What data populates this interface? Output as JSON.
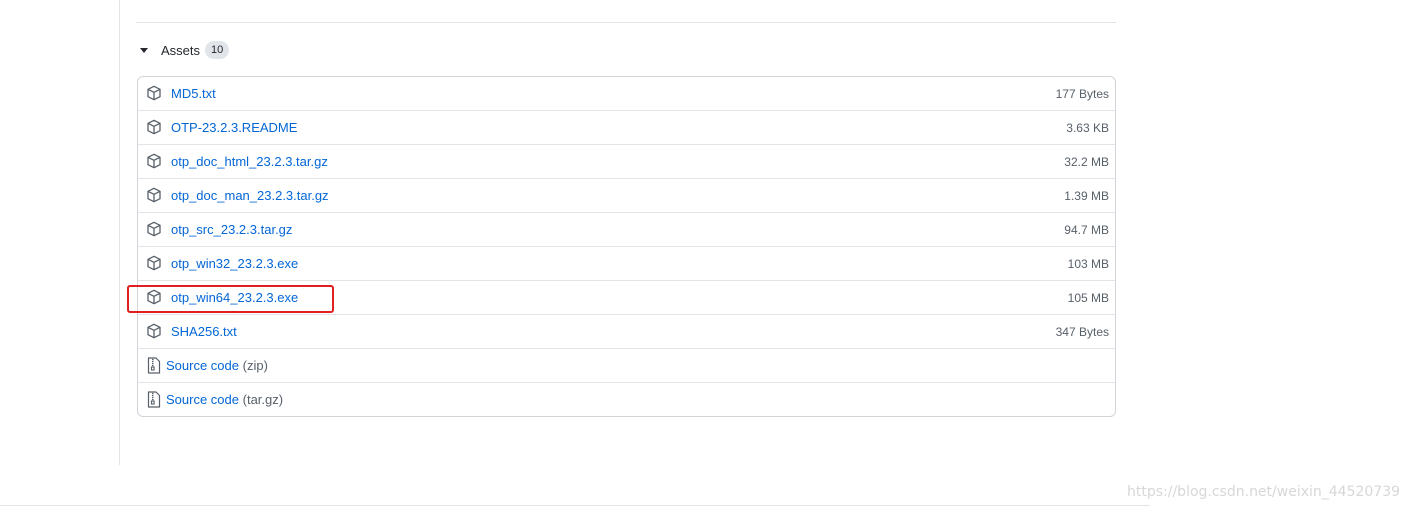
{
  "assets": {
    "title": "Assets",
    "count": "10",
    "items": [
      {
        "name": "MD5.txt",
        "size": "177 Bytes",
        "icon": "package-icon"
      },
      {
        "name": "OTP-23.2.3.README",
        "size": "3.63 KB",
        "icon": "package-icon"
      },
      {
        "name": "otp_doc_html_23.2.3.tar.gz",
        "size": "32.2 MB",
        "icon": "package-icon"
      },
      {
        "name": "otp_doc_man_23.2.3.tar.gz",
        "size": "1.39 MB",
        "icon": "package-icon"
      },
      {
        "name": "otp_src_23.2.3.tar.gz",
        "size": "94.7 MB",
        "icon": "package-icon"
      },
      {
        "name": "otp_win32_23.2.3.exe",
        "size": "103 MB",
        "icon": "package-icon"
      },
      {
        "name": "otp_win64_23.2.3.exe",
        "size": "105 MB",
        "icon": "package-icon",
        "highlighted": true
      },
      {
        "name": "SHA256.txt",
        "size": "347 Bytes",
        "icon": "package-icon"
      }
    ],
    "source_code": [
      {
        "label": "Source code",
        "format": "(zip)",
        "icon": "file-zip-icon"
      },
      {
        "label": "Source code",
        "format": "(tar.gz)",
        "icon": "file-zip-icon"
      }
    ]
  },
  "colors": {
    "link": "#0366d6",
    "muted": "#586069",
    "highlight": "#e02020"
  },
  "watermark": "https://blog.csdn.net/weixin_44520739"
}
